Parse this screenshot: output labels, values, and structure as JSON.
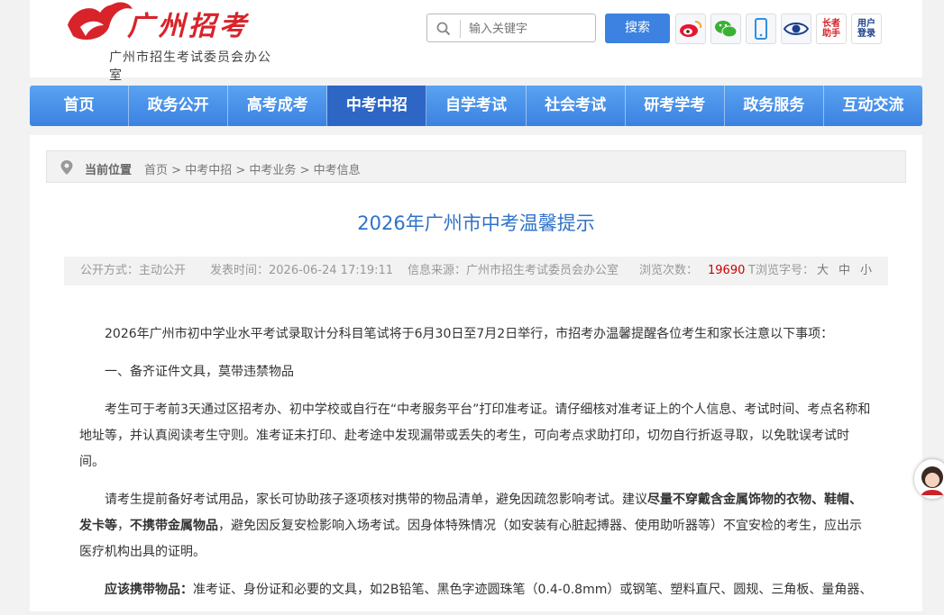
{
  "header": {
    "logo_text": "广州招考",
    "org_name": "广州市招生考试委员会办公室",
    "search_placeholder": "输入关键字",
    "search_button": "搜索",
    "elderly_label": "长者助手",
    "login_label": "用户登录",
    "icons": [
      "weibo-icon",
      "wechat-icon",
      "mobile-icon",
      "accessibility-eye-icon"
    ]
  },
  "nav": {
    "items": [
      "首页",
      "政务公开",
      "高考成考",
      "中考中招",
      "自学考试",
      "社会考试",
      "研考学考",
      "政务服务",
      "互动交流"
    ],
    "active": "中考中招"
  },
  "breadcrumb": {
    "label": "当前位置",
    "trail": [
      "首页",
      "中考中招",
      "中考业务",
      "中考信息"
    ],
    "separator": ">"
  },
  "article": {
    "title": "2026年广州市中考温馨提示",
    "meta": {
      "disclosure": "公开方式：主动公开",
      "published": "发表时间：2026-06-24 17:19:11",
      "source": "信息来源：广州市招生考试委员会办公室",
      "views_label": "浏览次数：",
      "views": "19690",
      "font_size_label": "T浏览字号：",
      "sizes": [
        "大",
        "中",
        "小"
      ]
    },
    "p1": "2026年广州市初中学业水平考试录取计分科目笔试将于6月30日至7月2日举行，市招考办温馨提醒各位考生和家长注意以下事项：",
    "p2": "一、备齐证件文具，莫带违禁物品",
    "p3": "考生可于考前3天通过区招考办、初中学校或自行在“中考服务平台”打印准考证。请仔细核对准考证上的个人信息、考试时间、考点名称和地址等，并认真阅读考生守则。准考证未打印、赴考途中发现漏带或丢失的考生，可向考点求助打印，切勿自行折返寻取，以免耽误考试时间。",
    "p4a": "请考生提前备好考试用品，家长可协助孩子逐项核对携带的物品清单，避免因疏忽影响考试。建议",
    "p4b": "尽量不穿戴含金属饰物的衣物、鞋帽、发卡等",
    "p4c": "，",
    "p4d": "不携带金属物品",
    "p4e": "，避免因反复安检影响入场考试。因身体特殊情况（如安装有心脏起搏器、使用助听器等）不宜安检的考生，应出示医疗机构出具的证明。",
    "p5a": "应该携带物品：",
    "p5b": "准考证、身份证和必要的文具，如2B铅笔、黑色字迹圆珠笔（0.4-0.8mm）或钢笔、塑料直尺、圆规、三角板、量角器、"
  },
  "colors": {
    "nav_blue": "#3a82e0",
    "nav_active": "#2e66c6",
    "title_blue": "#2f72c8",
    "views_red": "#cc0000",
    "logo_red": "#d8232a"
  }
}
